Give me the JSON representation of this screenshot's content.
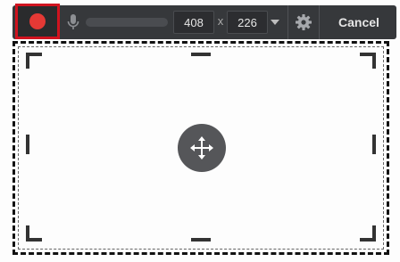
{
  "toolbar": {
    "record_button": {
      "icon": "record-icon",
      "color": "#e53935",
      "highlight_color": "#d0131f"
    },
    "mic_icon": "microphone-icon",
    "width_value": "408",
    "separator": "x",
    "height_value": "226",
    "dropdown_icon": "caret-down-icon",
    "settings_icon": "gear-icon",
    "cancel_label": "Cancel"
  },
  "capture_area": {
    "move_icon": "move-arrows-icon"
  }
}
